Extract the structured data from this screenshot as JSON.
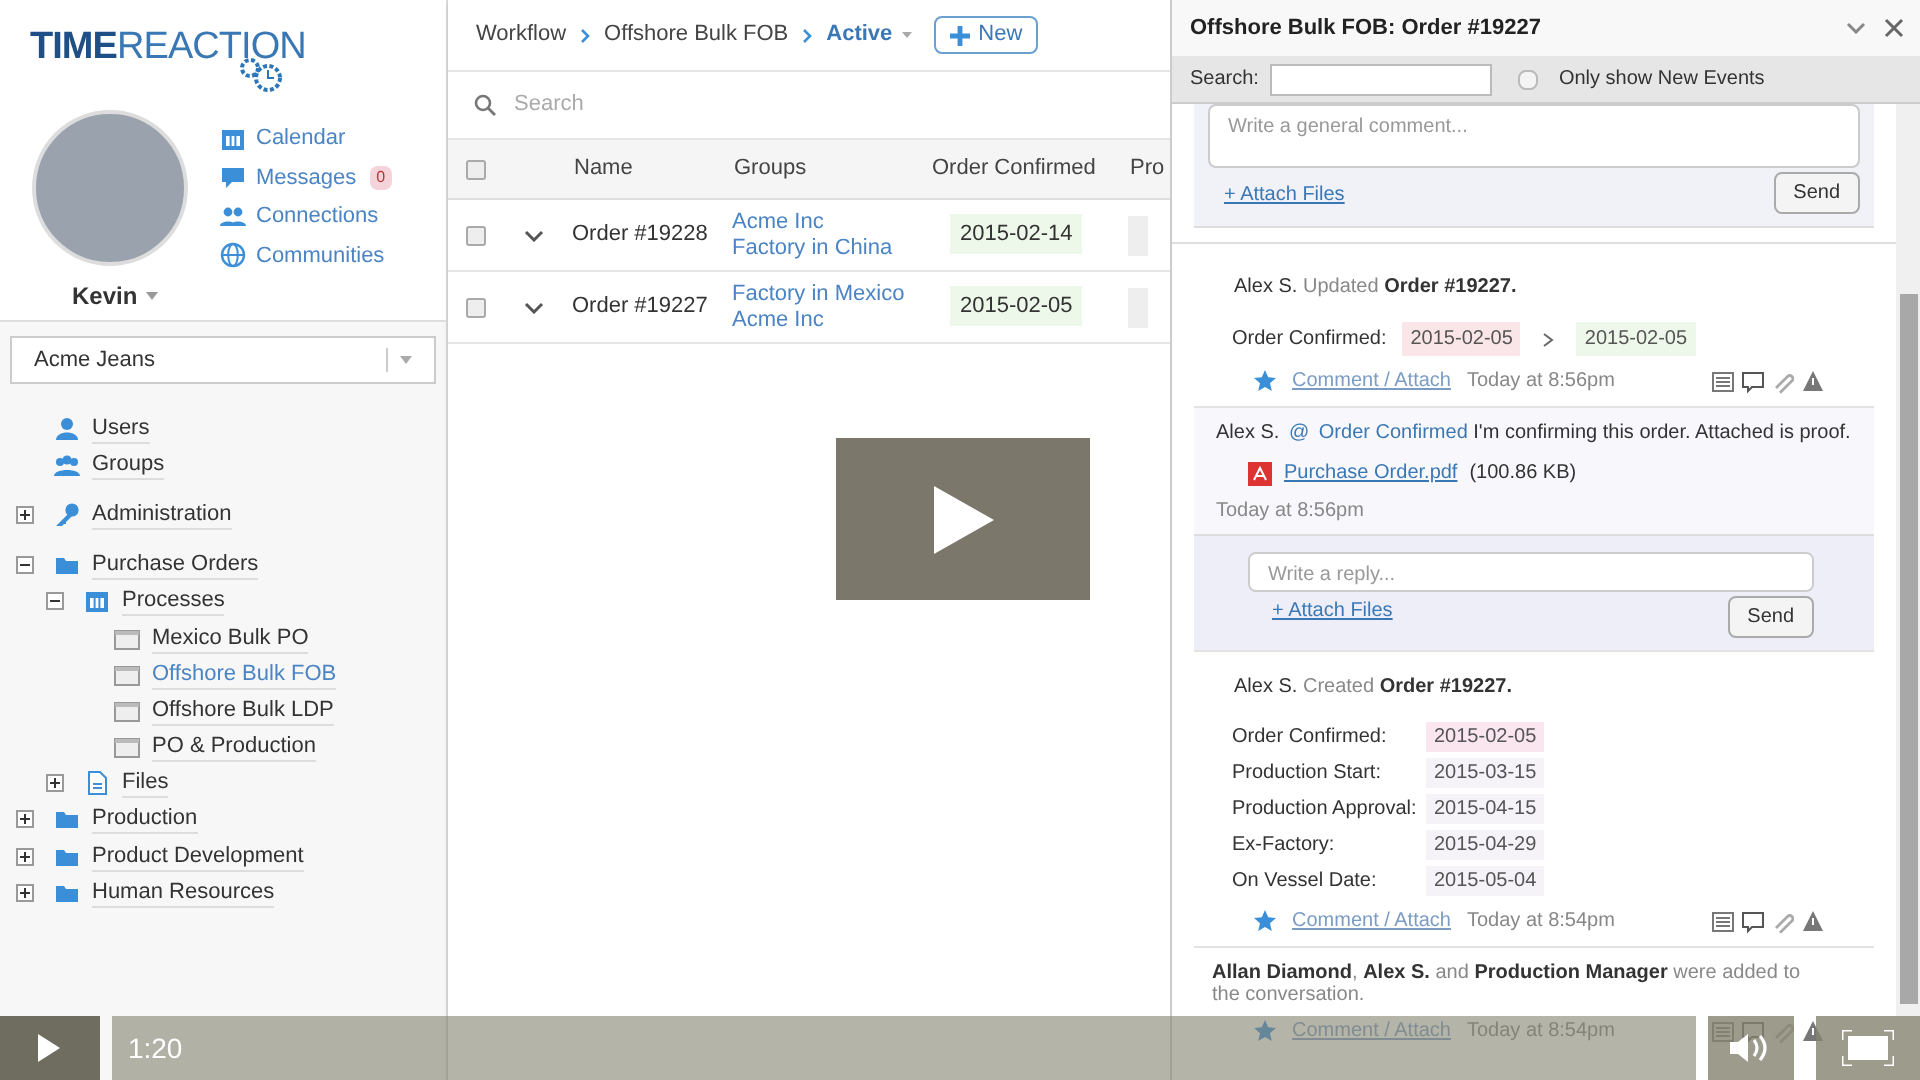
{
  "logo": {
    "bold": "TIME",
    "light": "REACTION"
  },
  "user": {
    "name": "Kevin"
  },
  "nav_links": [
    {
      "kind": "calendar",
      "label": "Calendar"
    },
    {
      "kind": "message",
      "label": "Messages",
      "badge": "0"
    },
    {
      "kind": "people",
      "label": "Connections"
    },
    {
      "kind": "globe",
      "label": "Communities"
    }
  ],
  "company_select": {
    "value": "Acme Jeans"
  },
  "tree": [
    {
      "kind": "user",
      "label": "Users"
    },
    {
      "kind": "group",
      "label": "Groups"
    },
    {
      "kind": "key",
      "label": "Administration",
      "expanded": false
    },
    {
      "kind": "folder",
      "label": "Purchase Orders",
      "expanded": true,
      "children": [
        {
          "kind": "calendar",
          "label": "Processes",
          "expanded": true,
          "children": [
            {
              "kind": "process",
              "label": "Mexico Bulk PO",
              "selected": false
            },
            {
              "kind": "process",
              "label": "Offshore Bulk FOB",
              "selected": true
            },
            {
              "kind": "process",
              "label": "Offshore Bulk LDP",
              "selected": false
            },
            {
              "kind": "process",
              "label": "PO & Production",
              "selected": false
            }
          ]
        },
        {
          "kind": "file",
          "label": "Files",
          "expanded": false
        }
      ]
    },
    {
      "kind": "folder",
      "label": "Production",
      "expanded": false
    },
    {
      "kind": "folder",
      "label": "Product Development",
      "expanded": false
    },
    {
      "kind": "folder",
      "label": "Human Resources",
      "expanded": false
    }
  ],
  "breadcrumb": [
    "Workflow",
    "Offshore Bulk FOB"
  ],
  "status_dropdown": "Active",
  "new_button": "New",
  "search": {
    "placeholder": "Search"
  },
  "table": {
    "select_all": {
      "checked": false
    },
    "columns": [
      "Name",
      "Groups",
      "Order Confirmed",
      "Pro"
    ],
    "rows": [
      {
        "checked": false,
        "name": "Order #19228",
        "groups": [
          "Acme Inc",
          "Factory in China"
        ],
        "order_confirmed": "2015-02-14"
      },
      {
        "checked": false,
        "name": "Order #19227",
        "groups": [
          "Factory in Mexico",
          "Acme Inc"
        ],
        "order_confirmed": "2015-02-05"
      }
    ]
  },
  "panel": {
    "title": "Offshore Bulk FOB: Order #19227",
    "search_label": "Search:",
    "new_events_only": {
      "label": "Only show New Events",
      "checked": false
    },
    "composer": {
      "placeholder": "Write a general comment...",
      "attach": "+ Attach Files",
      "send": "Send"
    },
    "events": [
      {
        "kind": "update",
        "actor": "Alex S.",
        "verb": "Updated",
        "object": "Order #19227.",
        "changes": [
          {
            "label": "Order Confirmed:",
            "old": "2015-02-05",
            "new": "2015-02-05"
          }
        ],
        "starred": true,
        "link": "Comment / Attach",
        "time": "Today at 8:56pm",
        "comments": [
          {
            "author": "Alex S.",
            "mention": "@",
            "ref": "Order Confirmed",
            "text": "I'm confirming this order. Attached is proof.",
            "file": "Purchase Order.pdf",
            "size": "(100.86 KB)",
            "time": "Today at 8:56pm"
          }
        ],
        "reply": {
          "placeholder": "Write a reply...",
          "attach": "+ Attach Files",
          "send": "Send"
        }
      },
      {
        "kind": "create",
        "actor": "Alex S.",
        "verb": "Created",
        "object": "Order #19227.",
        "fields": [
          {
            "label": "Order Confirmed:",
            "value": "2015-02-05",
            "highlighted": true
          },
          {
            "label": "Production Start:",
            "value": "2015-03-15",
            "highlighted": false
          },
          {
            "label": "Production Approval:",
            "value": "2015-04-15",
            "highlighted": false
          },
          {
            "label": "Ex-Factory:",
            "value": "2015-04-29",
            "highlighted": false
          },
          {
            "label": "On Vessel Date:",
            "value": "2015-05-04",
            "highlighted": false
          }
        ],
        "starred": true,
        "link": "Comment / Attach",
        "time": "Today at 8:54pm"
      },
      {
        "kind": "added",
        "text": "**Allan Diamond**, **Alex S.** and **Production Manager** were added to the conversation.",
        "starred": true,
        "link": "Comment / Attach",
        "time": "Today at 8:54pm"
      }
    ]
  },
  "video": {
    "time": "1:20",
    "level": 0
  }
}
